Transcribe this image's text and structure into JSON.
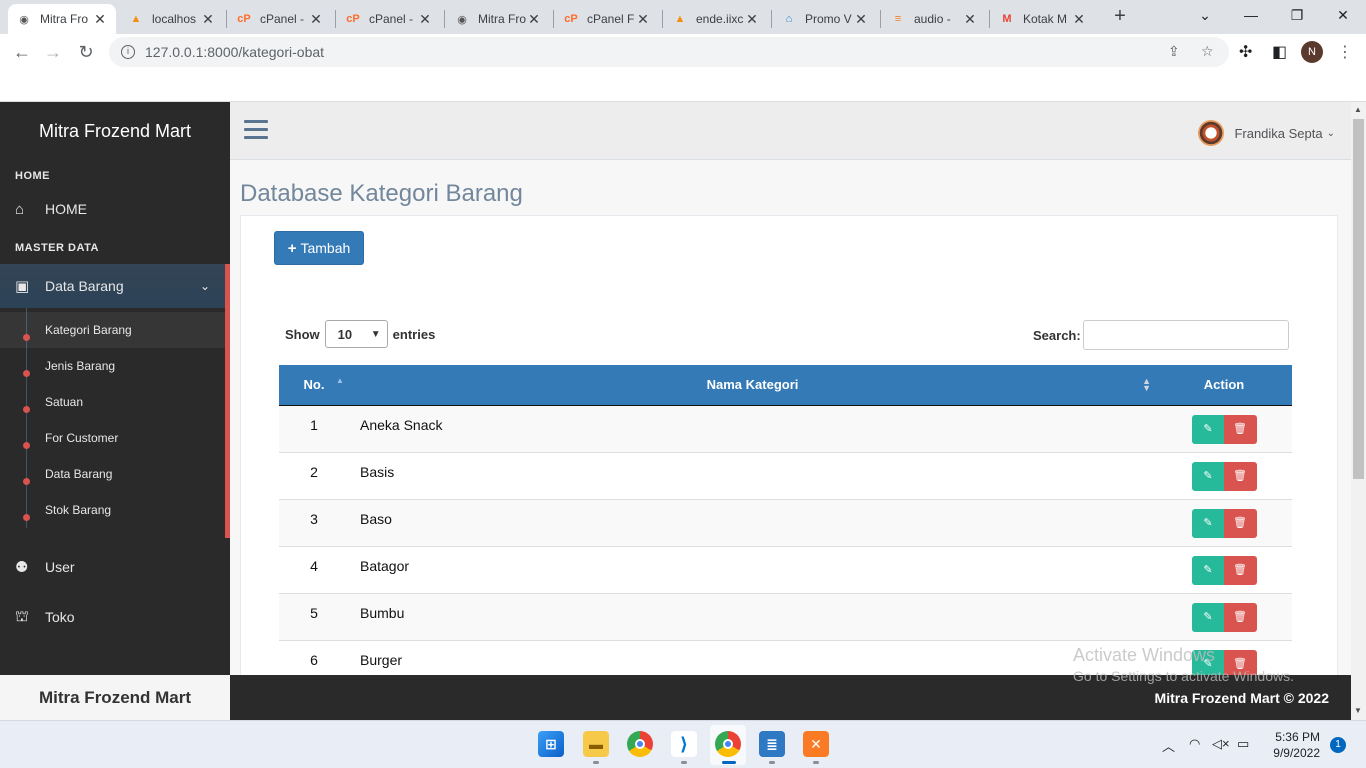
{
  "browser": {
    "tabs": [
      {
        "label": "Mitra Fro",
        "icon": "mitra-icon",
        "active": true
      },
      {
        "label": "localhos",
        "icon": "phpmyadmin-icon"
      },
      {
        "label": "cPanel -",
        "icon": "cpanel-icon"
      },
      {
        "label": "cPanel -",
        "icon": "cpanel-icon"
      },
      {
        "label": "Mitra Fro",
        "icon": "mitra-icon"
      },
      {
        "label": "cPanel F",
        "icon": "cpanel-icon"
      },
      {
        "label": "ende.iixc",
        "icon": "phpmyadmin-icon"
      },
      {
        "label": "Promo V",
        "icon": "promo-icon"
      },
      {
        "label": "audio -",
        "icon": "stackoverflow-icon"
      },
      {
        "label": "Kotak M",
        "icon": "gmail-icon"
      }
    ],
    "url": "127.0.0.1:8000/kategori-obat",
    "profile_initial": "N"
  },
  "sidebar": {
    "brand": "Mitra Frozend Mart",
    "section_home": "HOME",
    "home_label": "HOME",
    "section_master": "MASTER DATA",
    "data_barang_label": "Data Barang",
    "children": [
      "Kategori Barang",
      "Jenis Barang",
      "Satuan",
      "For Customer",
      "Data Barang",
      "Stok Barang"
    ],
    "user_label": "User",
    "toko_label": "Toko",
    "footer_brand": "Mitra Frozend Mart"
  },
  "topnav": {
    "user_name": "Frandika Septa"
  },
  "page": {
    "title": "Database Kategori Barang",
    "add_button": "Tambah",
    "show_label": "Show",
    "entries_value": "10",
    "entries_label": "entries",
    "search_label": "Search:"
  },
  "table": {
    "headers": [
      "No.",
      "Nama Kategori",
      "Action"
    ],
    "rows": [
      {
        "no": "1",
        "nama": "Aneka Snack"
      },
      {
        "no": "2",
        "nama": "Basis"
      },
      {
        "no": "3",
        "nama": "Baso"
      },
      {
        "no": "4",
        "nama": "Batagor"
      },
      {
        "no": "5",
        "nama": "Bumbu"
      },
      {
        "no": "6",
        "nama": "Burger"
      }
    ]
  },
  "footer": {
    "text": "Mitra Frozend Mart © 2022"
  },
  "watermark": {
    "line1": "Activate Windows",
    "line2": "Go to Settings to activate Windows."
  },
  "taskbar": {
    "time": "5:36 PM",
    "date": "9/9/2022",
    "notifications": "1"
  },
  "colors": {
    "primary": "#337ab7",
    "edit": "#26b99a",
    "delete": "#d9534f",
    "sidebar": "#2a2a2a"
  }
}
